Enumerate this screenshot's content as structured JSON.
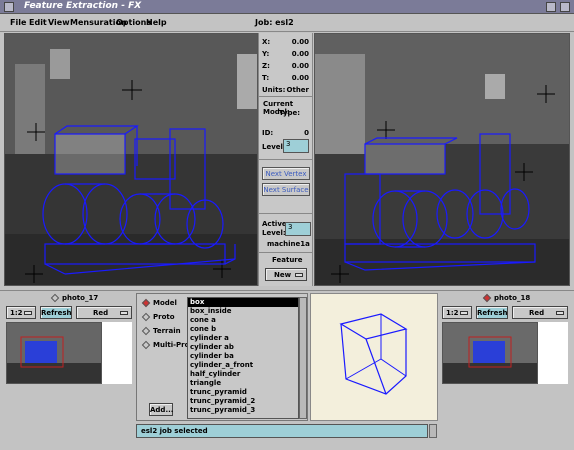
{
  "window": {
    "title": "Feature Extraction - FX"
  },
  "menu": {
    "file": "File",
    "edit": "Edit",
    "view": "View",
    "mensuration": "Mensuration",
    "options": "Options",
    "help": "Help"
  },
  "job_label": "Job: esl2",
  "coords": {
    "x_label": "X:",
    "x": "0.00",
    "y_label": "Y:",
    "y": "0.00",
    "z_label": "Z:",
    "z": "0.00",
    "t_label": "T:",
    "t": "0.00",
    "units_label": "Units:",
    "units": "Other"
  },
  "model": {
    "current_label": "Current Model:",
    "type_label": "Type:",
    "id_label": "ID:",
    "id": "0",
    "level_label": "Level:",
    "level": "3"
  },
  "buttons": {
    "next_vertex": "Next Vertex",
    "next_surface": "Next Surface",
    "add": "Add...",
    "refresh": "Refresh"
  },
  "active": {
    "label1": "Active",
    "label2": "Level:",
    "level": "3",
    "name": "machine1a"
  },
  "feature": {
    "label": "Feature",
    "value": "New"
  },
  "left_photo": {
    "name": "photo_17",
    "zoom": "1:2",
    "color": "Red"
  },
  "right_photo": {
    "name": "photo_18",
    "zoom": "1:2",
    "color": "Red"
  },
  "model_types": [
    "Model",
    "Proto",
    "Terrain",
    "Multi-Proto"
  ],
  "shapes": [
    "box",
    "box_inside",
    "cone a",
    "cone b",
    "cylinder a",
    "cylinder ab",
    "cylinder ba",
    "cylinder_a_front",
    "half_cylinder",
    "triangle",
    "trunc_pyramid",
    "trunc_pyramid_2",
    "trunc_pyramid_3"
  ],
  "status": "esl2 job selected"
}
